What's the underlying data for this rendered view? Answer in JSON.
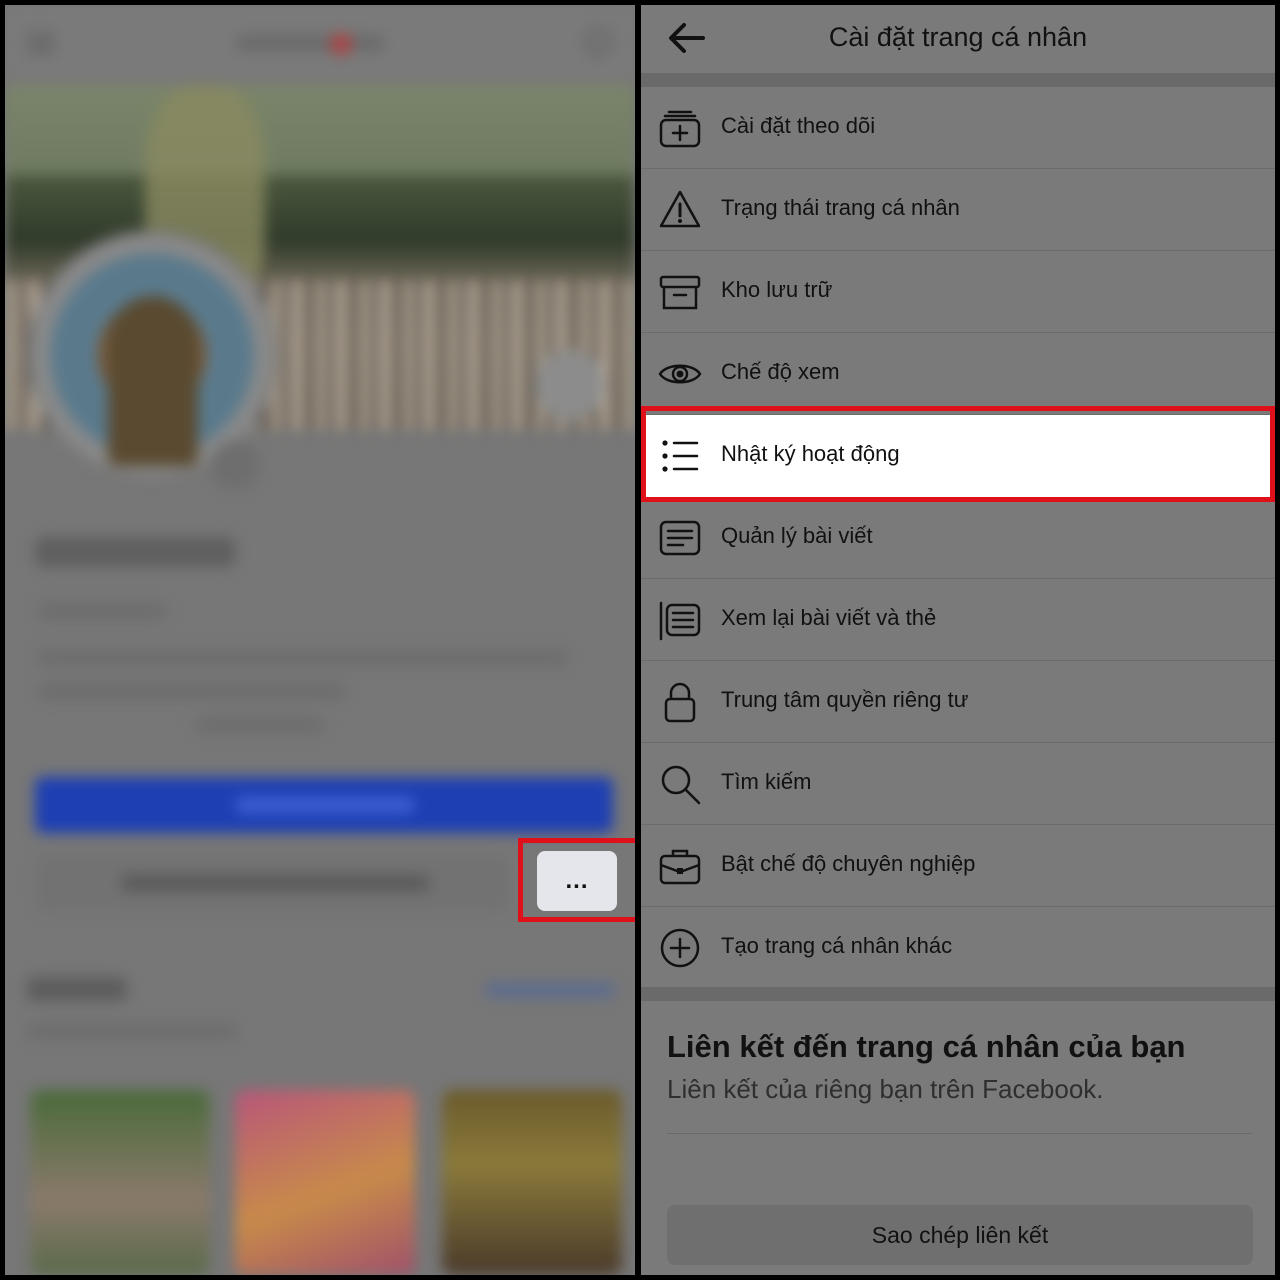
{
  "left_panel": {
    "more_button_label": "..."
  },
  "settings": {
    "title": "Cài đặt trang cá nhân",
    "items": [
      {
        "label": "Cài đặt theo dõi",
        "icon": "follow-settings-icon"
      },
      {
        "label": "Trạng thái trang cá nhân",
        "icon": "warning-icon"
      },
      {
        "label": "Kho lưu trữ",
        "icon": "archive-icon"
      },
      {
        "label": "Chế độ xem",
        "icon": "eye-icon"
      },
      {
        "label": "Nhật ký hoạt động",
        "icon": "list-icon",
        "active": true
      },
      {
        "label": "Quản lý bài viết",
        "icon": "posts-icon"
      },
      {
        "label": "Xem lại bài viết và thẻ",
        "icon": "review-tags-icon"
      },
      {
        "label": "Trung tâm quyền riêng tư",
        "icon": "lock-icon"
      },
      {
        "label": "Tìm kiếm",
        "icon": "search-icon"
      },
      {
        "label": "Bật chế độ chuyên nghiệp",
        "icon": "briefcase-icon"
      },
      {
        "label": "Tạo trang cá nhân khác",
        "icon": "plus-circle-icon"
      }
    ],
    "link_section": {
      "title": "Liên kết đến trang cá nhân của bạn",
      "subtitle": "Liên kết của riêng bạn trên Facebook.",
      "copy_button": "Sao chép liên kết"
    }
  },
  "colors": {
    "highlight": "#e0101a",
    "overlay": "#7a7a7a",
    "active_row": "#ffffff"
  }
}
